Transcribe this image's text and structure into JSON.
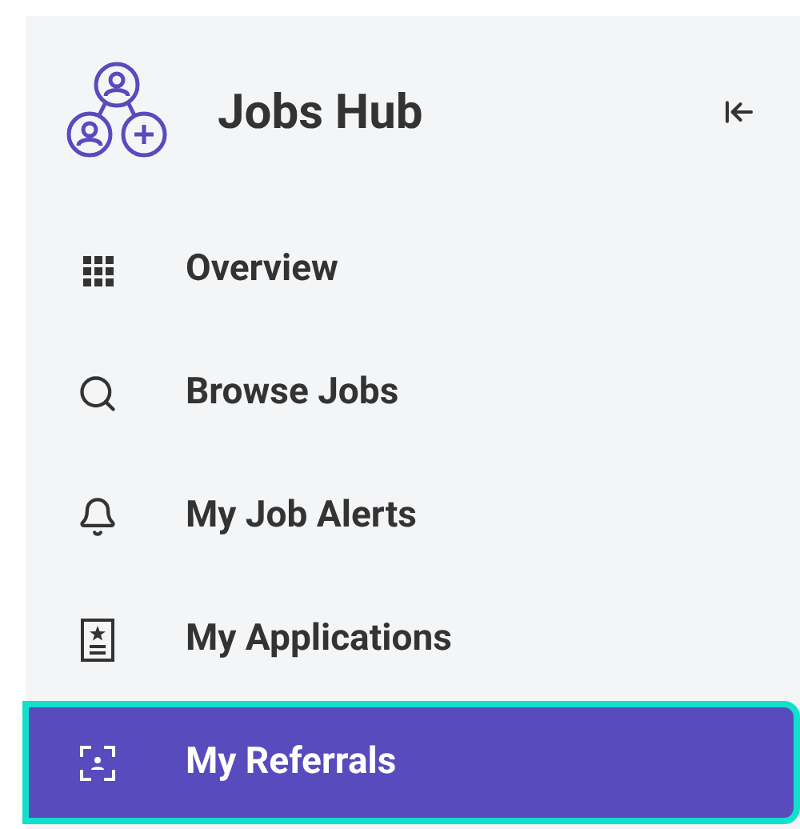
{
  "sidebar": {
    "title": "Jobs Hub",
    "items": [
      {
        "label": "Overview",
        "selected": false
      },
      {
        "label": "Browse Jobs",
        "selected": false
      },
      {
        "label": "My Job Alerts",
        "selected": false
      },
      {
        "label": "My Applications",
        "selected": false
      },
      {
        "label": "My Referrals",
        "selected": true
      }
    ]
  }
}
